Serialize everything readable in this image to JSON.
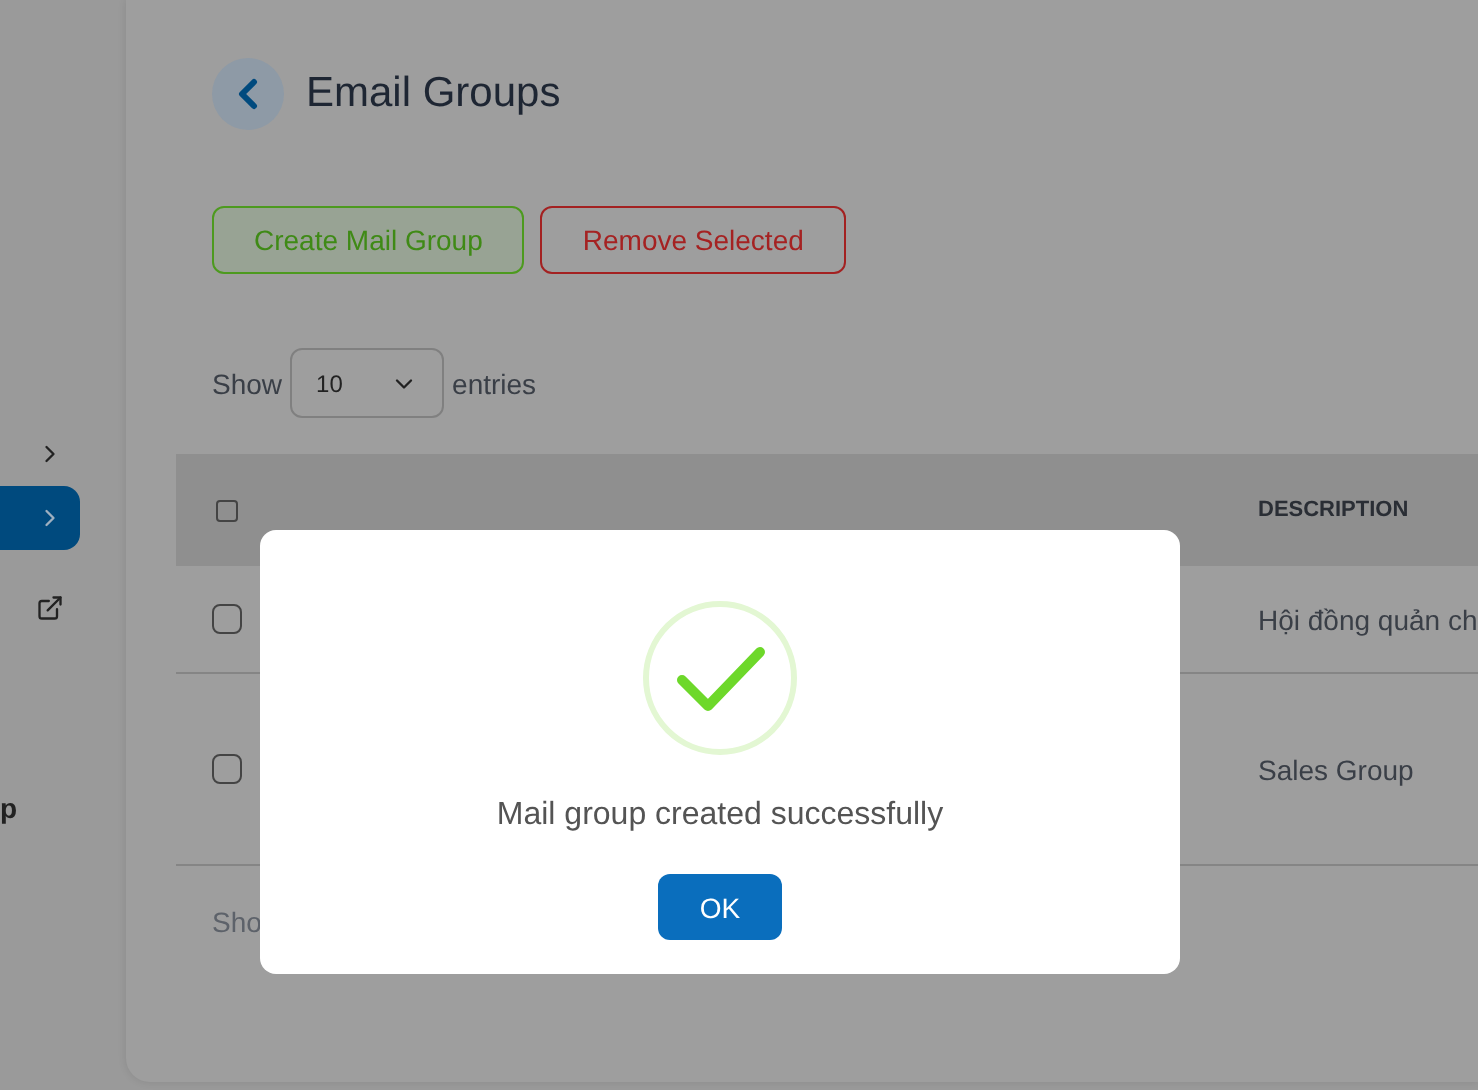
{
  "sidebar": {
    "items": [
      {
        "kind": "chevron",
        "selected": false
      },
      {
        "kind": "chevron",
        "selected": true
      },
      {
        "kind": "external",
        "selected": false
      },
      {
        "kind": "text",
        "label": "p",
        "selected": false
      }
    ]
  },
  "page": {
    "title": "Email Groups"
  },
  "actions": {
    "create": "Create Mail Group",
    "remove": "Remove Selected"
  },
  "entries": {
    "prefix": "Show",
    "value": "10",
    "suffix": "entries"
  },
  "table": {
    "columns": [
      {
        "kind": "checkbox",
        "checked": false
      },
      {
        "label": "DESCRIPTION",
        "kind": "text"
      }
    ],
    "rows": [
      {
        "checked": false,
        "description": "Hội đồng quản ch"
      },
      {
        "checked": false,
        "description": "Sales Group"
      }
    ]
  },
  "footer": "Sho",
  "dialog": {
    "message": "Mail group created successfully",
    "button": "OK"
  }
}
